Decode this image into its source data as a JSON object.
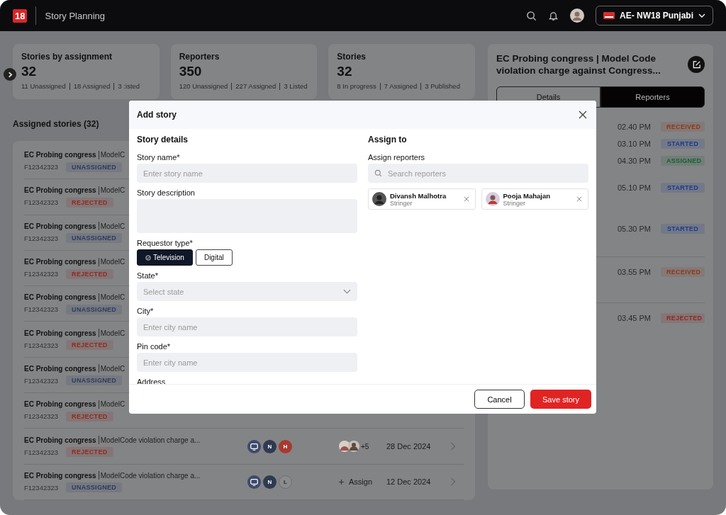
{
  "topbar": {
    "logo": "18",
    "title": "Story Planning",
    "channel": "AE- NW18 Punjabi"
  },
  "stats": [
    {
      "title": "Stories by assignment",
      "value": "32",
      "breakdown": [
        "11 Unassigned",
        "18 Assigned",
        "3 :isted"
      ]
    },
    {
      "title": "Reporters",
      "value": "350",
      "breakdown": [
        "120 Unassigned",
        "227 Assigned",
        "3 Listed"
      ]
    },
    {
      "title": "Stories",
      "value": "32",
      "breakdown": [
        "8 In progress",
        "7 Assigned",
        "3 Published"
      ]
    }
  ],
  "assigned": {
    "heading": "Assigned stories (32)",
    "rows": [
      {
        "title": "EC Probing congress",
        "subtitle": "ModelC",
        "id": "F12342323",
        "status": {
          "label": "UNASSIGNED",
          "color": "#2e3a5e"
        }
      },
      {
        "title": "EC Probing congress",
        "subtitle": "ModelC",
        "id": "F12342323",
        "status": {
          "label": "REJECTED",
          "color": "#8e2a20"
        }
      },
      {
        "title": "EC Probing congress",
        "subtitle": "ModelC",
        "id": "F12342323",
        "status": {
          "label": "UNASSIGNED",
          "color": "#2e3a5e"
        }
      },
      {
        "title": "EC Probing congress",
        "subtitle": "ModelC",
        "id": "F12342323",
        "status": {
          "label": "REJECTED",
          "color": "#8e2a20"
        }
      },
      {
        "title": "EC Probing congress",
        "subtitle": "ModelC",
        "id": "F12342323",
        "status": {
          "label": "UNASSIGNED",
          "color": "#2e3a5e"
        }
      },
      {
        "title": "EC Probing congress",
        "subtitle": "ModelC",
        "id": "F12342323",
        "status": {
          "label": "REJECTED",
          "color": "#8e2a20"
        }
      },
      {
        "title": "EC Probing congress",
        "subtitle": "ModelC",
        "id": "F12342323",
        "status": {
          "label": "UNASSIGNED",
          "color": "#2e3a5e"
        }
      },
      {
        "title": "EC Probing congress",
        "subtitle": "ModelC",
        "id": "F12342323",
        "status": {
          "label": "REJECTED",
          "color": "#8e2a20"
        }
      },
      {
        "title": "EC Probing congress",
        "subtitle": "ModelCode violation charge a...",
        "id": "F12342323",
        "status": {
          "label": "REJECTED",
          "color": "#8e2a20"
        },
        "tags": [
          {
            "kind": "tv"
          },
          {
            "kind": "filled",
            "label": "N",
            "color": "#2f3a52"
          },
          {
            "kind": "filled",
            "label": "H",
            "color": "#a83a30"
          }
        ],
        "more": "+5",
        "date": "28 Dec 2024"
      },
      {
        "title": "EC Probing congress",
        "subtitle": "ModelCode violation charge a...",
        "id": "F12342323",
        "status": {
          "label": "UNASSIGNED",
          "color": "#2e3a5e"
        },
        "tags": [
          {
            "kind": "tv"
          },
          {
            "kind": "filled",
            "label": "N",
            "color": "#2f3a52"
          },
          {
            "kind": "outline",
            "label": "L",
            "color": "#8a8b8d"
          }
        ],
        "assign": "Assign",
        "date": "12 Dec 2024"
      }
    ]
  },
  "detail": {
    "title": "EC Probing congress | Model Code violation charge against Congress...",
    "tabs": [
      {
        "label": "Details",
        "selected": false
      },
      {
        "label": "Reporters",
        "selected": true
      }
    ],
    "sections": [
      [
        {
          "time": "02.40 PM",
          "status": {
            "label": "RECEIVED",
            "color": "#8a3a1c"
          }
        },
        {
          "time": "03.10 PM",
          "status": {
            "label": "STARTED",
            "color": "#1c3a8a"
          }
        },
        {
          "time": "04.30 PM",
          "status": {
            "label": "ASSIGNED",
            "color": "#17602f"
          }
        },
        {
          "time": "05.10 PM",
          "status": {
            "label": "STARTED",
            "color": "#1c3a8a"
          }
        },
        {
          "time": "05.30 PM",
          "status": {
            "label": "STARTED",
            "color": "#1c3a8a"
          }
        }
      ],
      [
        {
          "time": "03.55 PM",
          "status": {
            "label": "RECEIVED",
            "color": "#8a3a1c"
          }
        }
      ],
      [
        {
          "time": "03.45 PM",
          "status": {
            "label": "REJECTED",
            "color": "#8e2a20"
          }
        }
      ]
    ]
  },
  "modal": {
    "title": "Add story",
    "left": {
      "heading": "Story details",
      "fields": [
        {
          "kind": "input",
          "label": "Story name*",
          "placeholder": "Enter story name"
        },
        {
          "kind": "textarea",
          "label": "Story description"
        },
        {
          "kind": "toggle",
          "label": "Requestor type*",
          "options": [
            {
              "label": "Television",
              "selected": true
            },
            {
              "label": "Digital",
              "selected": false
            }
          ]
        },
        {
          "kind": "select",
          "label": "State*",
          "placeholder": "Select state"
        },
        {
          "kind": "input",
          "label": "City*",
          "placeholder": "Enter city name"
        },
        {
          "kind": "input",
          "label": "Pin code*",
          "placeholder": "Enter city name"
        },
        {
          "kind": "label",
          "label": "Address"
        }
      ]
    },
    "right": {
      "heading": "Assign to",
      "label": "Assign reporters",
      "search_placeholder": "Search reporters",
      "reporters": [
        {
          "name": "Divansh Malhotra",
          "role": "Stringer"
        },
        {
          "name": "Pooja Mahajan",
          "role": "Stringer"
        }
      ]
    },
    "cancel": "Cancel",
    "save": "Save story"
  }
}
